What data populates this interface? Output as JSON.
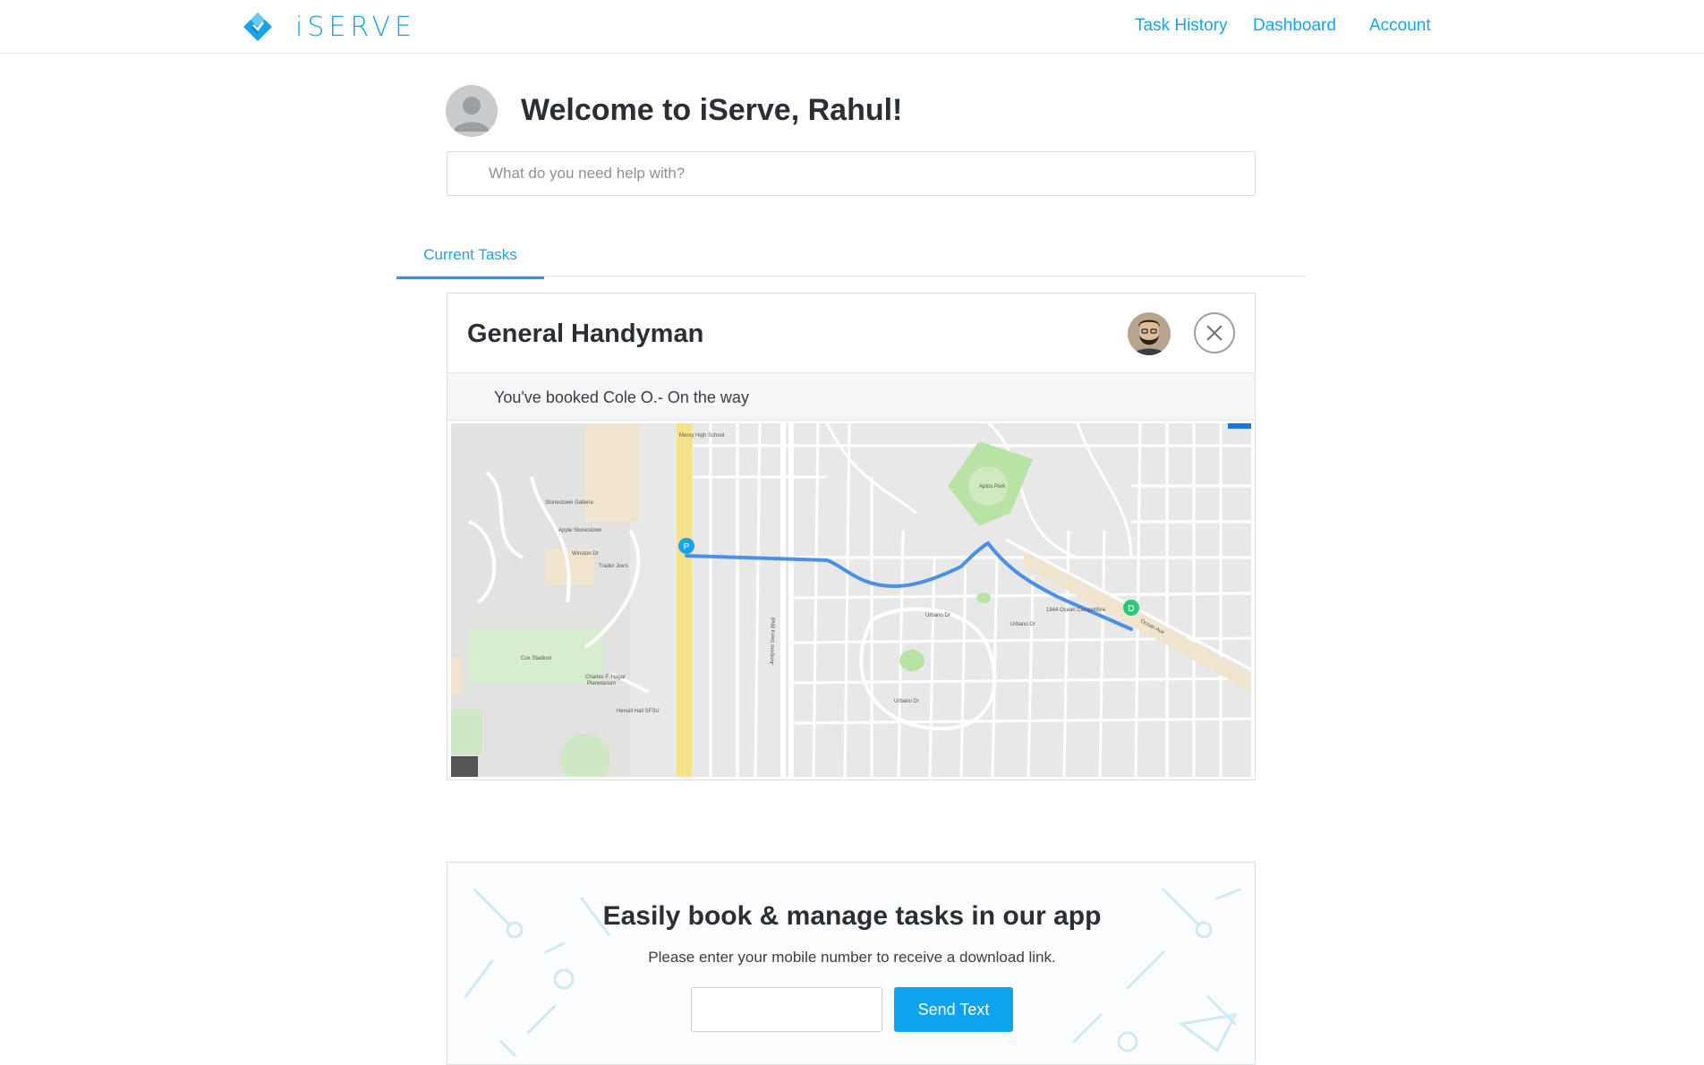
{
  "brand": {
    "name": "iSERVE",
    "logo_icon": "diamond-logo-icon",
    "accent_color": "#1aa3e8"
  },
  "nav": {
    "task_history": "Task History",
    "dashboard": "Dashboard",
    "account": "Account"
  },
  "welcome": {
    "avatar_icon": "user-avatar-placeholder-icon",
    "heading": "Welcome to iServe, Rahul!",
    "search_placeholder": "What do you need help with?"
  },
  "tabs": [
    {
      "label": "Current Tasks",
      "active": true
    }
  ],
  "task": {
    "title": "General Handyman",
    "pro_avatar": "pro-avatar-photo",
    "close_icon": "close-icon",
    "status": "You've booked Cole O.- On the way",
    "map": {
      "pickup_marker": "P",
      "dropoff_marker": "D",
      "route_color": "#4a8fe8",
      "labels": {
        "mercy_high": "Mercy High School",
        "stonestown": "Stonestown Galleria",
        "apple": "Apple Stonestown",
        "winston": "Winston Dr",
        "trader": "Trader Joe's",
        "cox": "Cox Stadium",
        "charles": "Charles F. Hagar",
        "charles2": "Planetarium",
        "hensill": "Hensill Hall SFSU",
        "aptos": "Aptos Park",
        "ocean": "1944 Ocean Competitive",
        "urbano": "Urbano Dr",
        "urbano2": "Urbano Dr",
        "urbano3": "Urbano Dr",
        "junipero": "Junipero Serra Blvd",
        "ocean_ave": "Ocean Ave"
      }
    }
  },
  "promo": {
    "title": "Easily book & manage tasks in our app",
    "subtitle": "Please enter your mobile number to receive a download link.",
    "phone_value": "",
    "send_label": "Send Text",
    "send_color": "#0fa3ee"
  }
}
